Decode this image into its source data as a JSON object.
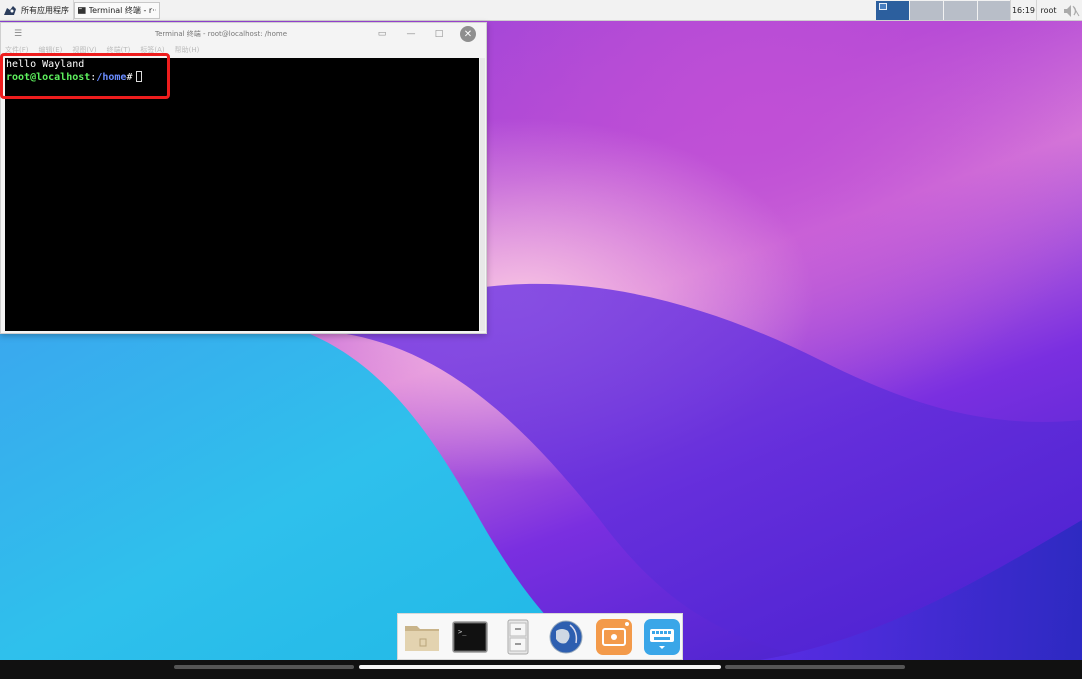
{
  "top_panel": {
    "apps_menu_label": "所有应用程序",
    "task_label": "Terminal 终端 - r···",
    "clock": "16:19",
    "user": "root"
  },
  "terminal": {
    "title": "Terminal 终端 - root@localhost: /home",
    "menu_items": [
      "文件(F)",
      "编辑(E)",
      "视图(V)",
      "终端(T)",
      "标签(A)",
      "帮助(H)"
    ],
    "output_line": "hello Wayland",
    "prompt_user": "root@localhost",
    "prompt_sep": ":",
    "prompt_path": "/home",
    "prompt_symbol": "#"
  },
  "dock": {
    "items": [
      "folder-icon",
      "terminal-icon",
      "file-cabinet-icon",
      "web-browser-icon",
      "screenshot-icon",
      "keyboard-icon"
    ]
  },
  "colors": {
    "highlight": "#ee1d1d",
    "prompt_user": "#5ef15e",
    "prompt_path": "#6a8cff",
    "workspace_active": "#2c5f9e"
  }
}
